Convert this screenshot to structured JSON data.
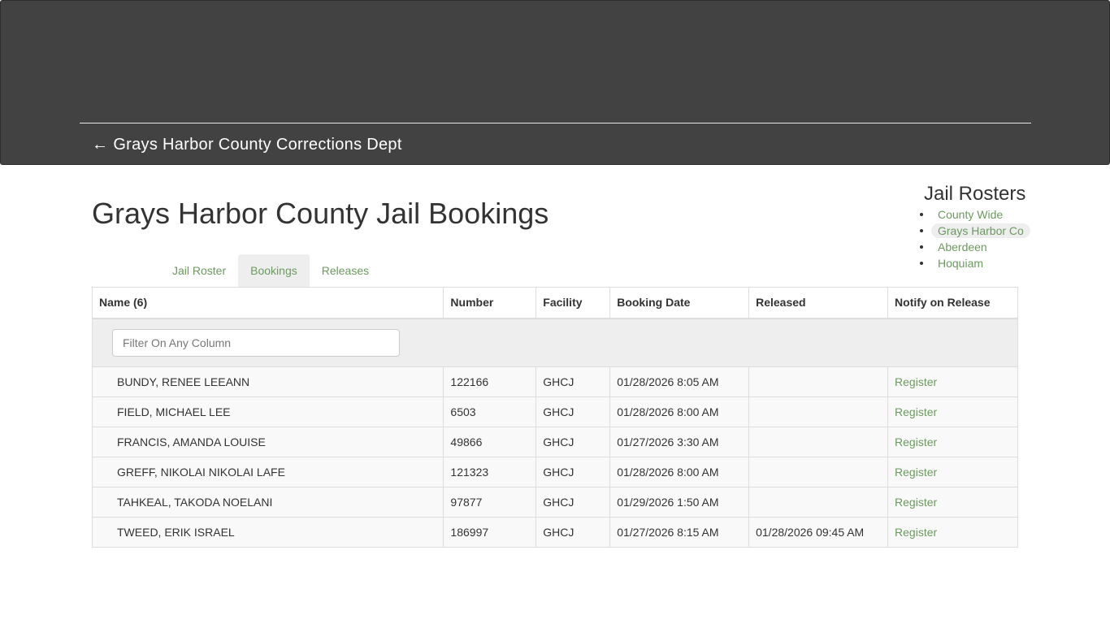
{
  "header": {
    "back_arrow": "←",
    "back_label": "Grays Harbor County Corrections Dept"
  },
  "page_title": "Grays Harbor County Jail Bookings",
  "rosters": {
    "title": "Jail Rosters",
    "items": [
      {
        "label": "County Wide",
        "active": false
      },
      {
        "label": "Grays Harbor Co",
        "active": true
      },
      {
        "label": "Aberdeen",
        "active": false
      },
      {
        "label": "Hoquiam",
        "active": false
      }
    ]
  },
  "tabs": [
    {
      "label": "Jail Roster",
      "active": false
    },
    {
      "label": "Bookings",
      "active": true
    },
    {
      "label": "Releases",
      "active": false
    }
  ],
  "table": {
    "columns": [
      "Name (6)",
      "Number",
      "Facility",
      "Booking Date",
      "Released",
      "Notify on Release"
    ],
    "filter_placeholder": "Filter On Any Column",
    "rows": [
      {
        "name": "BUNDY, RENEE LEEANN",
        "number": "122166",
        "facility": "GHCJ",
        "booking_date": "01/28/2026 8:05 AM",
        "released": "",
        "notify": "Register"
      },
      {
        "name": "FIELD, MICHAEL LEE",
        "number": "6503",
        "facility": "GHCJ",
        "booking_date": "01/28/2026 8:00 AM",
        "released": "",
        "notify": "Register"
      },
      {
        "name": "FRANCIS, AMANDA LOUISE",
        "number": "49866",
        "facility": "GHCJ",
        "booking_date": "01/27/2026 3:30 AM",
        "released": "",
        "notify": "Register"
      },
      {
        "name": "GREFF, NIKOLAI NIKOLAI LAFE",
        "number": "121323",
        "facility": "GHCJ",
        "booking_date": "01/28/2026 8:00 AM",
        "released": "",
        "notify": "Register"
      },
      {
        "name": "TAHKEAL, TAKODA NOELANI",
        "number": "97877",
        "facility": "GHCJ",
        "booking_date": "01/29/2026 1:50 AM",
        "released": "",
        "notify": "Register"
      },
      {
        "name": "TWEED, ERIK ISRAEL",
        "number": "186997",
        "facility": "GHCJ",
        "booking_date": "01/27/2026 8:15 AM",
        "released": "01/28/2026 09:45 AM",
        "notify": "Register"
      }
    ]
  },
  "colors": {
    "header_bg": "#424242",
    "link": "#6b9a5e",
    "active_bg": "#eeeeee"
  }
}
